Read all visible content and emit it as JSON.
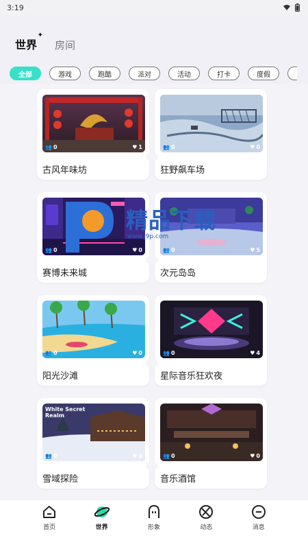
{
  "status": {
    "time": "3:19"
  },
  "tabs": {
    "world": "世界",
    "room": "房间"
  },
  "chips": [
    "全部",
    "游戏",
    "跑酷",
    "派对",
    "活动",
    "打卡",
    "度假"
  ],
  "cards": [
    {
      "title": "古风年味坊",
      "users": "0",
      "likes": "1"
    },
    {
      "title": "狂野飙车场",
      "users": "0",
      "likes": "0"
    },
    {
      "title": "赛博未来城",
      "users": "0",
      "likes": "0"
    },
    {
      "title": "次元岛岛",
      "users": "0",
      "likes": "5"
    },
    {
      "title": "阳光沙滩",
      "users": "0",
      "likes": "0"
    },
    {
      "title": "星际音乐狂欢夜",
      "users": "0",
      "likes": "4"
    },
    {
      "title": "雪域探险",
      "users": "0",
      "likes": "0",
      "thumb_text": "White Secret Realm"
    },
    {
      "title": "音乐酒馆",
      "users": "0",
      "likes": "0"
    }
  ],
  "watermark": {
    "text": "精品下载",
    "url": "www.j9p.com"
  },
  "nav": [
    "首页",
    "世界",
    "形象",
    "动态",
    "消息"
  ],
  "colors": {
    "accent": "#39e0c9",
    "nav_active": "#2fd8a8"
  }
}
